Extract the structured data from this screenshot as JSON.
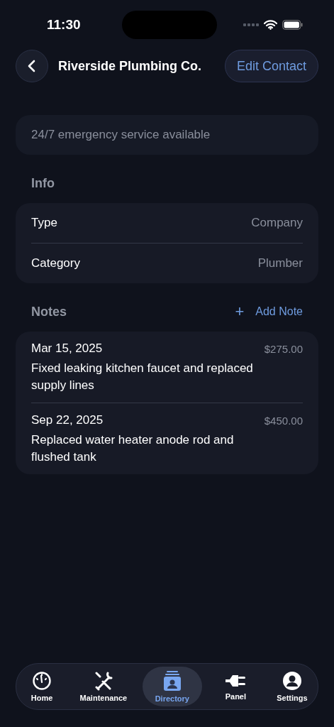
{
  "status_bar": {
    "time": "11:30"
  },
  "header": {
    "title": "Riverside Plumbing Co.",
    "action": "Edit Contact"
  },
  "note_field": {
    "value": "24/7 emergency service available"
  },
  "info": {
    "heading": "Info",
    "rows": [
      {
        "label": "Type",
        "value": "Company"
      },
      {
        "label": "Category",
        "value": "Plumber"
      }
    ]
  },
  "notes": {
    "heading": "Notes",
    "add_icon": "+",
    "add_label": "Add Note",
    "items": [
      {
        "date": "Mar 15, 2025",
        "amount": "$275.00",
        "text": "Fixed leaking kitchen faucet and replaced supply lines"
      },
      {
        "date": "Sep 22, 2025",
        "amount": "$450.00",
        "text": "Replaced water heater anode rod and flushed tank"
      }
    ]
  },
  "tab_bar": [
    {
      "label": "Home",
      "selected": false
    },
    {
      "label": "Maintenance",
      "selected": false
    },
    {
      "label": "Directory",
      "selected": true
    },
    {
      "label": "Panel",
      "selected": false
    },
    {
      "label": "Settings",
      "selected": false
    }
  ]
}
